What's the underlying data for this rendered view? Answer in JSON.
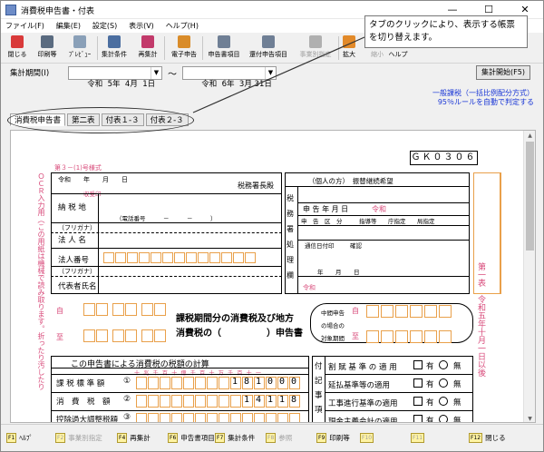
{
  "window": {
    "title": "消費税申告書・付表",
    "min": "—",
    "max": "☐",
    "close": "✕"
  },
  "menu": [
    "ファイル(F)",
    "編集(E)",
    "設定(S)",
    "表示(V)",
    "ヘルプ(H)"
  ],
  "toolbar": [
    {
      "label": "閉じる",
      "icon": "close-icon",
      "color": "#d93a3a",
      "disabled": false
    },
    {
      "label": "印刷等",
      "icon": "printer-icon",
      "color": "#5a6b80",
      "disabled": false
    },
    {
      "label": "ﾌﾟﾚﾋﾞｭｰ",
      "icon": "preview-icon",
      "color": "#8aa0b8",
      "disabled": false
    },
    {
      "label": "集計条件",
      "icon": "conditions-icon",
      "color": "#4b6ea0",
      "disabled": false
    },
    {
      "label": "再集計",
      "icon": "recalc-icon",
      "color": "#c23a6b",
      "disabled": false
    },
    {
      "label": "電子申告",
      "icon": "e-filing-icon",
      "color": "#d98c2a",
      "disabled": false
    },
    {
      "label": "申告書項目",
      "icon": "form-items-icon",
      "color": "#6f7f95",
      "disabled": false
    },
    {
      "label": "還付申告項目",
      "icon": "refund-items-icon",
      "color": "#6f7f95",
      "disabled": false
    },
    {
      "label": "事業別指定",
      "icon": "business-type-icon",
      "color": "#b0b0b0",
      "disabled": true
    },
    {
      "label": "拡大",
      "icon": "zoom-in-icon",
      "color": "#e28a2a",
      "disabled": false
    },
    {
      "label": "縮小",
      "icon": "zoom-out-icon",
      "color": "#c0c0c0",
      "disabled": true
    },
    {
      "label": "ヘルプ",
      "icon": "help-icon",
      "color": "#c0c0c0",
      "disabled": false
    }
  ],
  "tooltip": "タブのクリックにより、表示する帳票を切り替えます。",
  "period": {
    "label": "集計期間(I)",
    "from": "令和  5年  4月  1日",
    "tilde": "〜",
    "to": "令和  6年  3月 31日"
  },
  "calc_button": "集計開始(F5)",
  "method": {
    "line1": "一般課税（一括比例配分方式）",
    "line2": "95％ルールを自動で判定する"
  },
  "tabs": [
    {
      "label": "消費税申告書",
      "active": true
    },
    {
      "label": "第二表",
      "active": false
    },
    {
      "label": "付表１-３",
      "active": false
    },
    {
      "label": "付表２-３",
      "active": false
    }
  ],
  "form": {
    "gk_code": "ＧＫ０３０６",
    "form_no": "第３－(1)号様式",
    "date_header": "令和　　年　　月　　日",
    "receipt": "収受印",
    "tax_office": "税務署長殿",
    "address_label": "納 税 地",
    "phone": "（電話番号　　　－　　　－　　　）",
    "furigana": "（フリガナ）",
    "corp_name": "法 人 名",
    "corp_no": "法人番号",
    "rep_name": "代表者氏名",
    "individual": "（個人の方）　振替継続希望",
    "office_side": [
      "税",
      "務",
      "署",
      "処",
      "理",
      "欄"
    ],
    "filing_date": "申 告 年 月 日",
    "era": "令和",
    "filing_cols": [
      "申　告　区　分",
      "指導等",
      "庁指定",
      "局指定"
    ],
    "commun": [
      "通信日付印",
      "確認"
    ],
    "ym": [
      "年",
      "月",
      "日"
    ],
    "title_line1": "課税期間分の消費税及び地方",
    "title_line2": "消費税の（　　　　　）申告書",
    "mid_label1": "中間申告",
    "mid_label2": "の場合の",
    "mid_label3": "対象期間",
    "from_to": [
      "自",
      "至"
    ],
    "calc_title": "この申告書による消費税の税額の計算",
    "digits": "十 兆 千 百 十 億 千 百 十 万 千 百 十 一",
    "rows": [
      {
        "label": "課 税 標 準 額",
        "no": "①",
        "value": "181000"
      },
      {
        "label": "消　費　税　額",
        "no": "②",
        "value": "14118"
      },
      {
        "label": "控除過大調整税額",
        "no": "③",
        "value": ""
      }
    ],
    "right_section": {
      "side": [
        "付",
        "記",
        "事",
        "項"
      ],
      "rows": [
        {
          "label": "割 賦 基 準 の 適 用",
          "yes": "有",
          "no": "無"
        },
        {
          "label": "延払基準等の適用",
          "yes": "有",
          "no": "無"
        },
        {
          "label": "工事進行基準の適用",
          "yes": "有",
          "no": "無"
        },
        {
          "label": "現金主義会計の適用",
          "yes": "有",
          "no": "無"
        }
      ]
    },
    "vertical_left": "ＯＣＲ入力用（この用紙は機械で読み取ります。折ったり汚したり",
    "vertical_right": "第一表　令和五年十月一日以後"
  },
  "fnkeys": [
    {
      "key": "F1",
      "label": "ﾍﾙﾌﾟ",
      "disabled": false
    },
    {
      "key": "F2",
      "label": "事業別指定",
      "disabled": true
    },
    {
      "key": "F4",
      "label": "再集計",
      "disabled": false
    },
    {
      "key": "F6",
      "label": "申告書項目",
      "disabled": false
    },
    {
      "key": "F7",
      "label": "集計条件",
      "disabled": false
    },
    {
      "key": "F8",
      "label": "参照",
      "disabled": true
    },
    {
      "key": "F9",
      "label": "印刷等",
      "disabled": false
    },
    {
      "key": "F10",
      "label": "",
      "disabled": true
    },
    {
      "key": "F11",
      "label": "",
      "disabled": true
    },
    {
      "key": "F12",
      "label": "閉じる",
      "disabled": false
    }
  ]
}
